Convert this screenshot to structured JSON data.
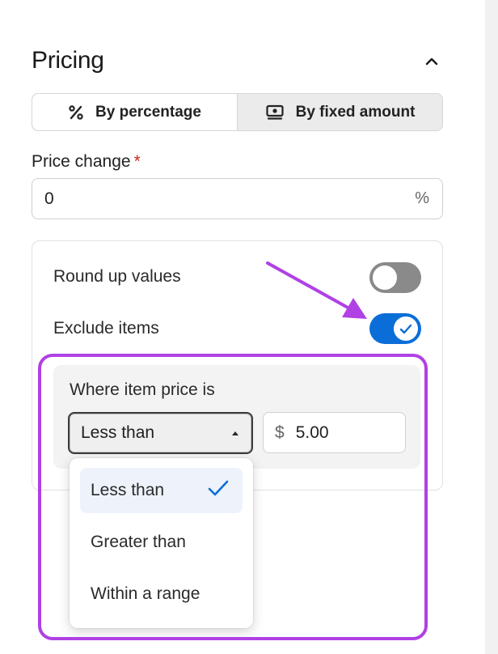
{
  "section": {
    "title": "Pricing",
    "collapse_icon": "chevron-up-icon"
  },
  "pricing_mode": {
    "options": [
      {
        "label": "By percentage",
        "icon": "percent-icon",
        "active": true
      },
      {
        "label": "By fixed amount",
        "icon": "cash-icon",
        "active": false
      }
    ]
  },
  "price_change": {
    "label": "Price change",
    "required_mark": "*",
    "value": "0",
    "suffix": "%"
  },
  "options": {
    "round_up": {
      "label": "Round up values",
      "enabled": false
    },
    "exclude_items": {
      "label": "Exclude items",
      "enabled": true
    }
  },
  "exclude_rule": {
    "label": "Where item price is",
    "condition": {
      "selected": "Less than"
    },
    "amount": {
      "prefix": "$",
      "value": "5.00"
    }
  },
  "condition_dropdown": {
    "items": [
      {
        "label": "Less than",
        "selected": true
      },
      {
        "label": "Greater than",
        "selected": false
      },
      {
        "label": "Within a range",
        "selected": false
      }
    ]
  },
  "colors": {
    "accent": "#0b6ed8",
    "annotation": "#b041e4",
    "required": "#c5281c"
  }
}
